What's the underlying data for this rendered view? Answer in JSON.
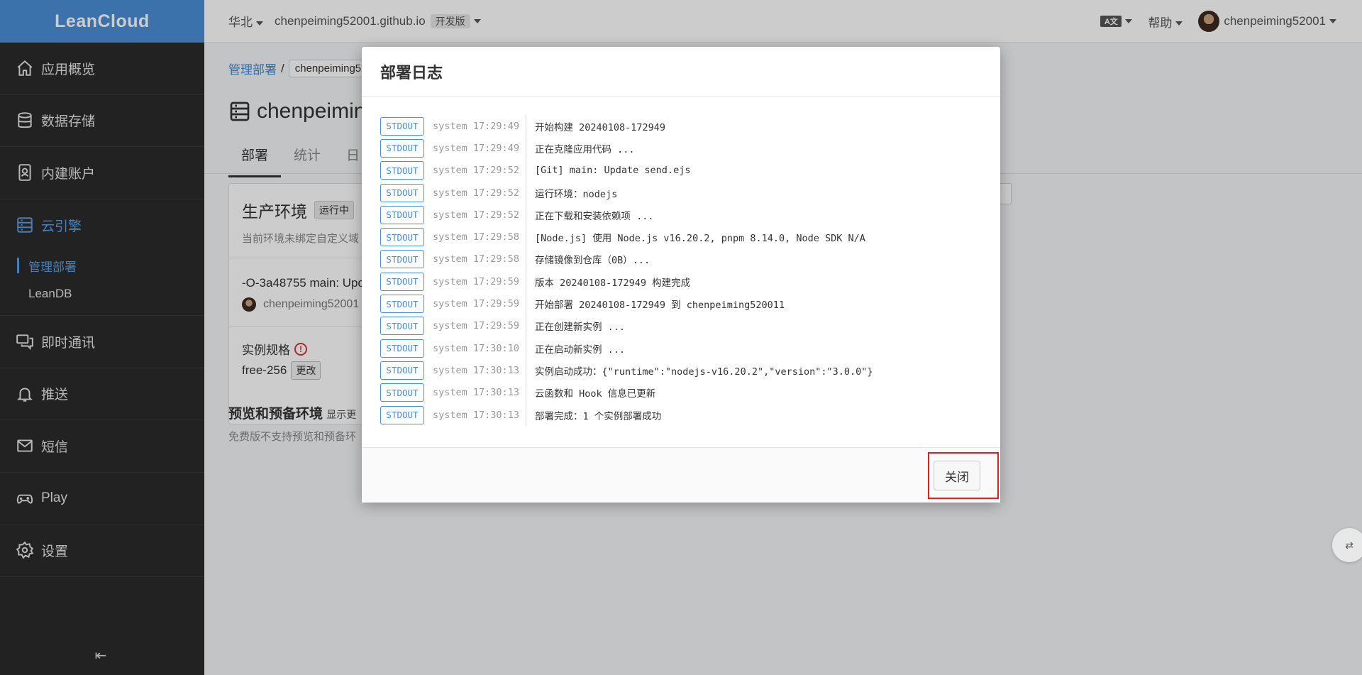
{
  "sidebar": {
    "brand": "LeanCloud",
    "items": [
      {
        "label": "应用概览",
        "icon": "home-icon"
      },
      {
        "label": "数据存储",
        "icon": "database-icon"
      },
      {
        "label": "内建账户",
        "icon": "user-card-icon"
      },
      {
        "label": "云引擎",
        "icon": "server-icon",
        "active": true
      },
      {
        "label": "即时通讯",
        "icon": "chat-icon"
      },
      {
        "label": "推送",
        "icon": "bell-icon"
      },
      {
        "label": "短信",
        "icon": "mail-icon"
      },
      {
        "label": "Play",
        "icon": "gamepad-icon"
      },
      {
        "label": "设置",
        "icon": "gear-icon"
      }
    ],
    "subitems": [
      {
        "label": "管理部署",
        "active": true
      },
      {
        "label": "LeanDB"
      }
    ]
  },
  "topbar": {
    "region": "华北",
    "app_name": "chenpeiming52001.github.io",
    "plan": "开发版",
    "lang_icon_text": "A文",
    "help": "帮助",
    "username": "chenpeiming52001"
  },
  "main": {
    "breadcrumb_link": "管理部署",
    "breadcrumb_sep": "/",
    "breadcrumb_current": "chenpeiming5",
    "app_title": "chenpeimin",
    "tabs": [
      "部署",
      "统计",
      "日"
    ],
    "env_title": "生产环境",
    "env_status": "运行中",
    "env_note": "当前环境未绑定自定义域",
    "commit": "-O-3a48755 main: Upd",
    "committer": "chenpeiming52001",
    "spec_label": "实例规格",
    "spec_value": "free-256",
    "spec_change": "更改",
    "preview_title": "预览和预备环境",
    "preview_sub": "显示更",
    "preview_note": "免费版不支持预览和预备环"
  },
  "modal": {
    "title": "部署日志",
    "close_label": "关闭",
    "logs": [
      {
        "stream": "STDOUT",
        "source": "system",
        "time": "17:29:49",
        "msg": "开始构建 20240108-172949"
      },
      {
        "stream": "STDOUT",
        "source": "system",
        "time": "17:29:49",
        "msg": "正在克隆应用代码 ..."
      },
      {
        "stream": "STDOUT",
        "source": "system",
        "time": "17:29:52",
        "msg": "[Git] main: Update send.ejs"
      },
      {
        "stream": "STDOUT",
        "source": "system",
        "time": "17:29:52",
        "msg": "运行环境：nodejs"
      },
      {
        "stream": "STDOUT",
        "source": "system",
        "time": "17:29:52",
        "msg": "正在下载和安装依赖项 ..."
      },
      {
        "stream": "STDOUT",
        "source": "system",
        "time": "17:29:58",
        "msg": "[Node.js] 使用 Node.js v16.20.2, pnpm 8.14.0, Node SDK N/A"
      },
      {
        "stream": "STDOUT",
        "source": "system",
        "time": "17:29:58",
        "msg": "存储镜像到仓库（0B）..."
      },
      {
        "stream": "STDOUT",
        "source": "system",
        "time": "17:29:59",
        "msg": "版本 20240108-172949 构建完成"
      },
      {
        "stream": "STDOUT",
        "source": "system",
        "time": "17:29:59",
        "msg": "开始部署 20240108-172949 到 chenpeiming520011"
      },
      {
        "stream": "STDOUT",
        "source": "system",
        "time": "17:29:59",
        "msg": "正在创建新实例 ..."
      },
      {
        "stream": "STDOUT",
        "source": "system",
        "time": "17:30:10",
        "msg": "正在启动新实例 ..."
      },
      {
        "stream": "STDOUT",
        "source": "system",
        "time": "17:30:13",
        "msg": "实例启动成功：{\"runtime\":\"nodejs-v16.20.2\",\"version\":\"3.0.0\"}"
      },
      {
        "stream": "STDOUT",
        "source": "system",
        "time": "17:30:13",
        "msg": "云函数和 Hook 信息已更新"
      },
      {
        "stream": "STDOUT",
        "source": "system",
        "time": "17:30:13",
        "msg": "部署完成：1 个实例部署成功"
      }
    ]
  },
  "colors": {
    "brand": "#4a8fd6",
    "sidebar_bg": "#2b2b2b",
    "active": "#5aa0ea",
    "highlight": "#e02020"
  }
}
